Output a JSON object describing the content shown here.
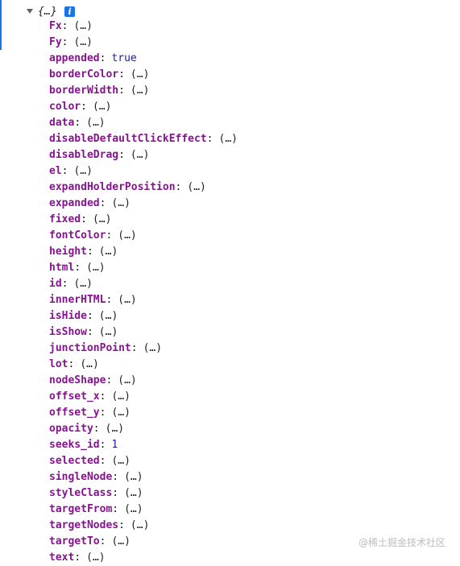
{
  "object": {
    "preview": "{…}",
    "info_icon": "i"
  },
  "properties": [
    {
      "key": "Fx",
      "value": "(…)",
      "type": "lazy"
    },
    {
      "key": "Fy",
      "value": "(…)",
      "type": "lazy"
    },
    {
      "key": "appended",
      "value": "true",
      "type": "bool"
    },
    {
      "key": "borderColor",
      "value": "(…)",
      "type": "lazy"
    },
    {
      "key": "borderWidth",
      "value": "(…)",
      "type": "lazy"
    },
    {
      "key": "color",
      "value": "(…)",
      "type": "lazy"
    },
    {
      "key": "data",
      "value": "(…)",
      "type": "lazy"
    },
    {
      "key": "disableDefaultClickEffect",
      "value": "(…)",
      "type": "lazy"
    },
    {
      "key": "disableDrag",
      "value": "(…)",
      "type": "lazy"
    },
    {
      "key": "el",
      "value": "(…)",
      "type": "lazy"
    },
    {
      "key": "expandHolderPosition",
      "value": "(…)",
      "type": "lazy"
    },
    {
      "key": "expanded",
      "value": "(…)",
      "type": "lazy"
    },
    {
      "key": "fixed",
      "value": "(…)",
      "type": "lazy"
    },
    {
      "key": "fontColor",
      "value": "(…)",
      "type": "lazy"
    },
    {
      "key": "height",
      "value": "(…)",
      "type": "lazy"
    },
    {
      "key": "html",
      "value": "(…)",
      "type": "lazy"
    },
    {
      "key": "id",
      "value": "(…)",
      "type": "lazy"
    },
    {
      "key": "innerHTML",
      "value": "(…)",
      "type": "lazy"
    },
    {
      "key": "isHide",
      "value": "(…)",
      "type": "lazy"
    },
    {
      "key": "isShow",
      "value": "(…)",
      "type": "lazy"
    },
    {
      "key": "junctionPoint",
      "value": "(…)",
      "type": "lazy"
    },
    {
      "key": "lot",
      "value": "(…)",
      "type": "lazy"
    },
    {
      "key": "nodeShape",
      "value": "(…)",
      "type": "lazy"
    },
    {
      "key": "offset_x",
      "value": "(…)",
      "type": "lazy"
    },
    {
      "key": "offset_y",
      "value": "(…)",
      "type": "lazy"
    },
    {
      "key": "opacity",
      "value": "(…)",
      "type": "lazy"
    },
    {
      "key": "seeks_id",
      "value": "1",
      "type": "num"
    },
    {
      "key": "selected",
      "value": "(…)",
      "type": "lazy"
    },
    {
      "key": "singleNode",
      "value": "(…)",
      "type": "lazy"
    },
    {
      "key": "styleClass",
      "value": "(…)",
      "type": "lazy"
    },
    {
      "key": "targetFrom",
      "value": "(…)",
      "type": "lazy"
    },
    {
      "key": "targetNodes",
      "value": "(…)",
      "type": "lazy"
    },
    {
      "key": "targetTo",
      "value": "(…)",
      "type": "lazy"
    },
    {
      "key": "text",
      "value": "(…)",
      "type": "lazy"
    }
  ],
  "watermark": "@稀土掘金技术社区",
  "colors": {
    "key": "#881391",
    "literal": "#1a1aa6",
    "accent": "#1a73e8"
  }
}
